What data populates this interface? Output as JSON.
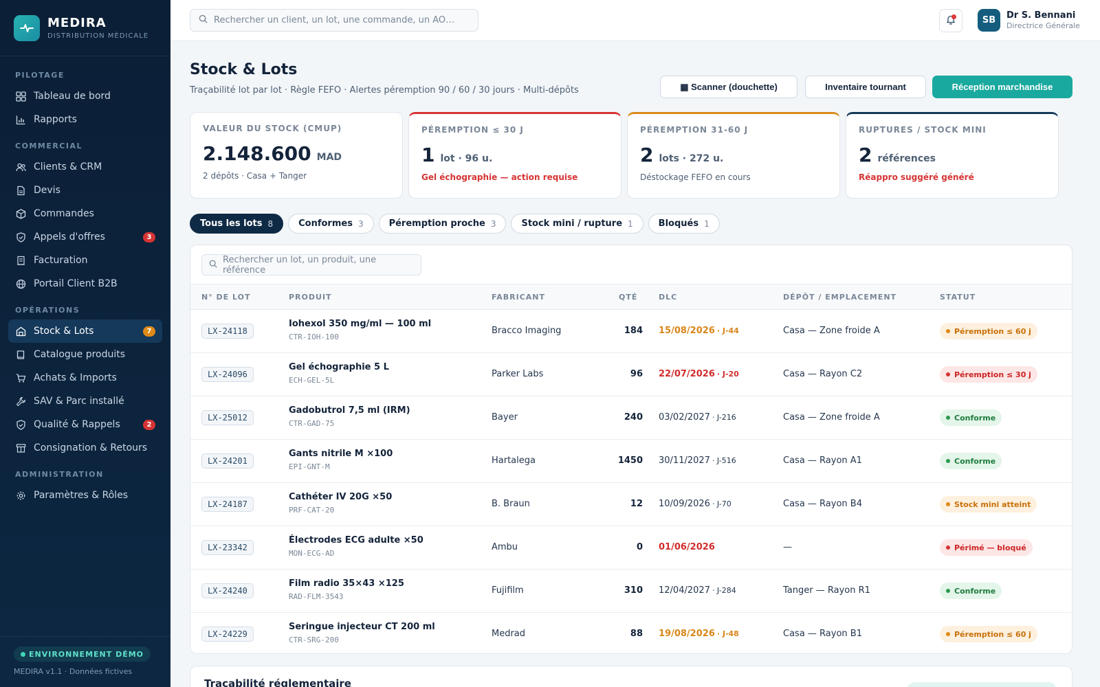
{
  "brand": {
    "name": "MEDIRA",
    "sub": "DISTRIBUTION MÉDICALE"
  },
  "nav": {
    "sections": [
      {
        "title": "PILOTAGE",
        "items": [
          {
            "label": "Tableau de bord",
            "icon": "dashboard-icon"
          },
          {
            "label": "Rapports",
            "icon": "chart-icon"
          }
        ]
      },
      {
        "title": "COMMERCIAL",
        "items": [
          {
            "label": "Clients & CRM",
            "icon": "users-icon"
          },
          {
            "label": "Devis",
            "icon": "document-icon"
          },
          {
            "label": "Commandes",
            "icon": "box-icon"
          },
          {
            "label": "Appels d'offres",
            "icon": "shield-icon",
            "badge": "3"
          },
          {
            "label": "Facturation",
            "icon": "invoice-icon"
          },
          {
            "label": "Portail Client B2B",
            "icon": "globe-icon"
          }
        ]
      },
      {
        "title": "OPÉRATIONS",
        "items": [
          {
            "label": "Stock & Lots",
            "icon": "warehouse-icon",
            "badge": "7",
            "active": true
          },
          {
            "label": "Catalogue produits",
            "icon": "book-icon"
          },
          {
            "label": "Achats & Imports",
            "icon": "cart-icon"
          },
          {
            "label": "SAV & Parc installé",
            "icon": "wrench-icon"
          },
          {
            "label": "Qualité & Rappels",
            "icon": "shield-icon",
            "badge": "2"
          },
          {
            "label": "Consignation & Retours",
            "icon": "archive-icon"
          }
        ]
      },
      {
        "title": "ADMINISTRATION",
        "items": [
          {
            "label": "Paramètres & Rôles",
            "icon": "gear-icon"
          }
        ]
      }
    ]
  },
  "footer": {
    "env": "ENVIRONNEMENT DÉMO",
    "version": "MEDIRA v1.1 · Données fictives"
  },
  "topbar": {
    "search_placeholder": "Rechercher un client, un lot, une commande, un AO…",
    "avatar": "SB",
    "user_name": "Dr S. Bennani",
    "user_role": "Directrice Générale"
  },
  "page": {
    "title": "Stock & Lots",
    "subtitle": "Traçabilité lot par lot · Règle FEFO · Alertes péremption 90 / 60 / 30 jours · Multi-dépôts",
    "buttons": {
      "scanner": "▦ Scanner (douchette)",
      "inventaire": "Inventaire tournant",
      "reception": "Réception marchandise"
    }
  },
  "kpis": [
    {
      "label": "VALEUR DU STOCK (CMUP)",
      "value": "2.148.600",
      "unit": "MAD",
      "foot": "2 dépôts · Casa + Tanger",
      "accent": "none",
      "alert": false
    },
    {
      "label": "PÉREMPTION ≤ 30 J",
      "value": "1",
      "unit": "lot · 96 u.",
      "foot": "Gel échographie — action requise",
      "accent": "red",
      "alert": true
    },
    {
      "label": "PÉREMPTION 31-60 J",
      "value": "2",
      "unit": "lots · 272 u.",
      "foot": "Déstockage FEFO en cours",
      "accent": "orange",
      "alert": false
    },
    {
      "label": "RUPTURES / STOCK MINI",
      "value": "2",
      "unit": "références",
      "foot": "Réappro suggéré généré",
      "accent": "navy",
      "alert": true
    }
  ],
  "filters": [
    {
      "label": "Tous les lots",
      "count": "8",
      "active": true
    },
    {
      "label": "Conformes",
      "count": "3"
    },
    {
      "label": "Péremption proche",
      "count": "3"
    },
    {
      "label": "Stock mini / rupture",
      "count": "1"
    },
    {
      "label": "Bloqués",
      "count": "1"
    }
  ],
  "table": {
    "search_placeholder": "Rechercher un lot, un produit, une référence",
    "headers": [
      "N° DE LOT",
      "PRODUIT",
      "FABRICANT",
      "QTÉ",
      "DLC",
      "DÉPÔT / EMPLACEMENT",
      "STATUT"
    ],
    "rows": [
      {
        "lot": "LX-24118",
        "product": "Iohexol 350 mg/ml — 100 ml",
        "ref": "CTR-IOH-100",
        "maker": "Bracco Imaging",
        "qty": "184",
        "dlc": "15/08/2026",
        "dlc_j": "· J-44",
        "dlc_tone": "orange",
        "depot": "Casa — Zone froide A",
        "status": "Péremption ≤ 60 j",
        "status_tone": "orange"
      },
      {
        "lot": "LX-24096",
        "product": "Gel échographie 5 L",
        "ref": "ECH-GEL-5L",
        "maker": "Parker Labs",
        "qty": "96",
        "dlc": "22/07/2026",
        "dlc_j": "· J-20",
        "dlc_tone": "red",
        "depot": "Casa — Rayon C2",
        "status": "Péremption ≤ 30 j",
        "status_tone": "red"
      },
      {
        "lot": "LX-25012",
        "product": "Gadobutrol 7,5 ml (IRM)",
        "ref": "CTR-GAD-75",
        "maker": "Bayer",
        "qty": "240",
        "dlc": "03/02/2027",
        "dlc_j": "· J-216",
        "dlc_tone": "normal",
        "depot": "Casa — Zone froide A",
        "status": "Conforme",
        "status_tone": "green"
      },
      {
        "lot": "LX-24201",
        "product": "Gants nitrile M ×100",
        "ref": "EPI-GNT-M",
        "maker": "Hartalega",
        "qty": "1450",
        "dlc": "30/11/2027",
        "dlc_j": "· J-516",
        "dlc_tone": "normal",
        "depot": "Casa — Rayon A1",
        "status": "Conforme",
        "status_tone": "green"
      },
      {
        "lot": "LX-24187",
        "product": "Cathéter IV 20G ×50",
        "ref": "PRF-CAT-20",
        "maker": "B. Braun",
        "qty": "12",
        "dlc": "10/09/2026",
        "dlc_j": "· J-70",
        "dlc_tone": "normal",
        "depot": "Casa — Rayon B4",
        "status": "Stock mini atteint",
        "status_tone": "orange"
      },
      {
        "lot": "LX-23342",
        "product": "Électrodes ECG adulte ×50",
        "ref": "MON-ECG-AD",
        "maker": "Ambu",
        "qty": "0",
        "dlc": "01/06/2026",
        "dlc_j": "",
        "dlc_tone": "red",
        "depot": "—",
        "status": "Périmé — bloqué",
        "status_tone": "red"
      },
      {
        "lot": "LX-24240",
        "product": "Film radio 35×43 ×125",
        "ref": "RAD-FLM-3543",
        "maker": "Fujifilm",
        "qty": "310",
        "dlc": "12/04/2027",
        "dlc_j": "· J-284",
        "dlc_tone": "normal",
        "depot": "Tanger — Rayon R1",
        "status": "Conforme",
        "status_tone": "green"
      },
      {
        "lot": "LX-24229",
        "product": "Seringue injecteur CT 200 ml",
        "ref": "CTR-SRG-200",
        "maker": "Medrad",
        "qty": "88",
        "dlc": "19/08/2026",
        "dlc_j": "· J-48",
        "dlc_tone": "orange",
        "depot": "Casa — Rayon B1",
        "status": "Péremption ≤ 60 j",
        "status_tone": "orange"
      }
    ]
  },
  "traceability": {
    "title": "Traçabilité réglementaire"
  },
  "colors": {
    "accent": "#1aa99e",
    "sidebar": "#0b1f36",
    "danger": "#d63434",
    "warning": "#e08a17",
    "success": "#2b9a4f"
  }
}
